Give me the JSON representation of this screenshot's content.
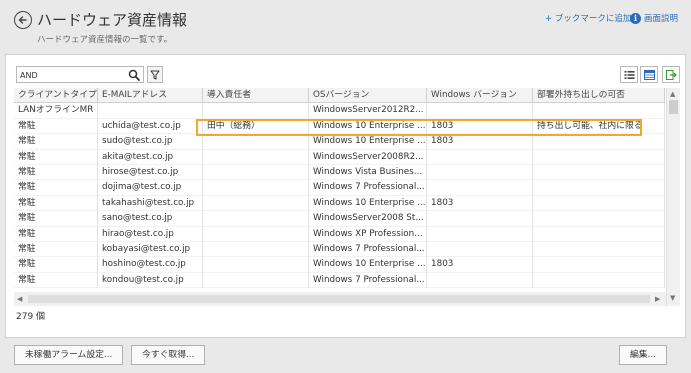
{
  "header": {
    "title": "ハードウェア資産情報",
    "subtitle": "ハードウェア資産情報の一覧です。",
    "bookmark_label": "+ ブックマークに追加",
    "help_label": "画面説明"
  },
  "toolbar": {
    "search_value": "AND",
    "search_placeholder": ""
  },
  "table": {
    "columns": [
      "クライアントタイプ",
      "E-MAILアドレス",
      "導入責任者",
      "OSバージョン",
      "Windows バージョン",
      "部署外持ち出しの可否"
    ],
    "rows": [
      [
        "LANオフラインMR",
        "",
        "",
        "WindowsServer2012R2...",
        "",
        ""
      ],
      [
        "常駐",
        "uchida@test.co.jp",
        "田中（総務）",
        "Windows 10 Enterprise ...",
        "1803",
        "持ち出し可能、社内に限る"
      ],
      [
        "常駐",
        "sudo@test.co.jp",
        "",
        "Windows 10 Enterprise ...",
        "1803",
        ""
      ],
      [
        "常駐",
        "akita@test.co.jp",
        "",
        "WindowsServer2008R2...",
        "",
        ""
      ],
      [
        "常駐",
        "hirose@test.co.jp",
        "",
        "Windows Vista Busines...",
        "",
        ""
      ],
      [
        "常駐",
        "dojima@test.co.jp",
        "",
        "Windows 7 Professional...",
        "",
        ""
      ],
      [
        "常駐",
        "takahashi@test.co.jp",
        "",
        "Windows 10 Enterprise ...",
        "1803",
        ""
      ],
      [
        "常駐",
        "sano@test.co.jp",
        "",
        "WindowsServer2008 St...",
        "",
        ""
      ],
      [
        "常駐",
        "hirao@test.co.jp",
        "",
        "Windows XP Profession...",
        "",
        ""
      ],
      [
        "常駐",
        "kobayasi@test.co.jp",
        "",
        "Windows 7 Professional...",
        "",
        ""
      ],
      [
        "常駐",
        "hoshino@test.co.jp",
        "",
        "Windows 10 Enterprise ...",
        "1803",
        ""
      ],
      [
        "常駐",
        "kondou@test.co.jp",
        "",
        "Windows 7 Professional...",
        "",
        ""
      ]
    ]
  },
  "footer": {
    "count": "279 個",
    "alarm_button": "未稼働アラーム設定...",
    "fetch_button": "今すぐ取得...",
    "edit_button": "編集..."
  },
  "colors": {
    "link": "#2a6cb5",
    "highlight": "#f0a830",
    "export_icon": "#3c9a3c"
  }
}
